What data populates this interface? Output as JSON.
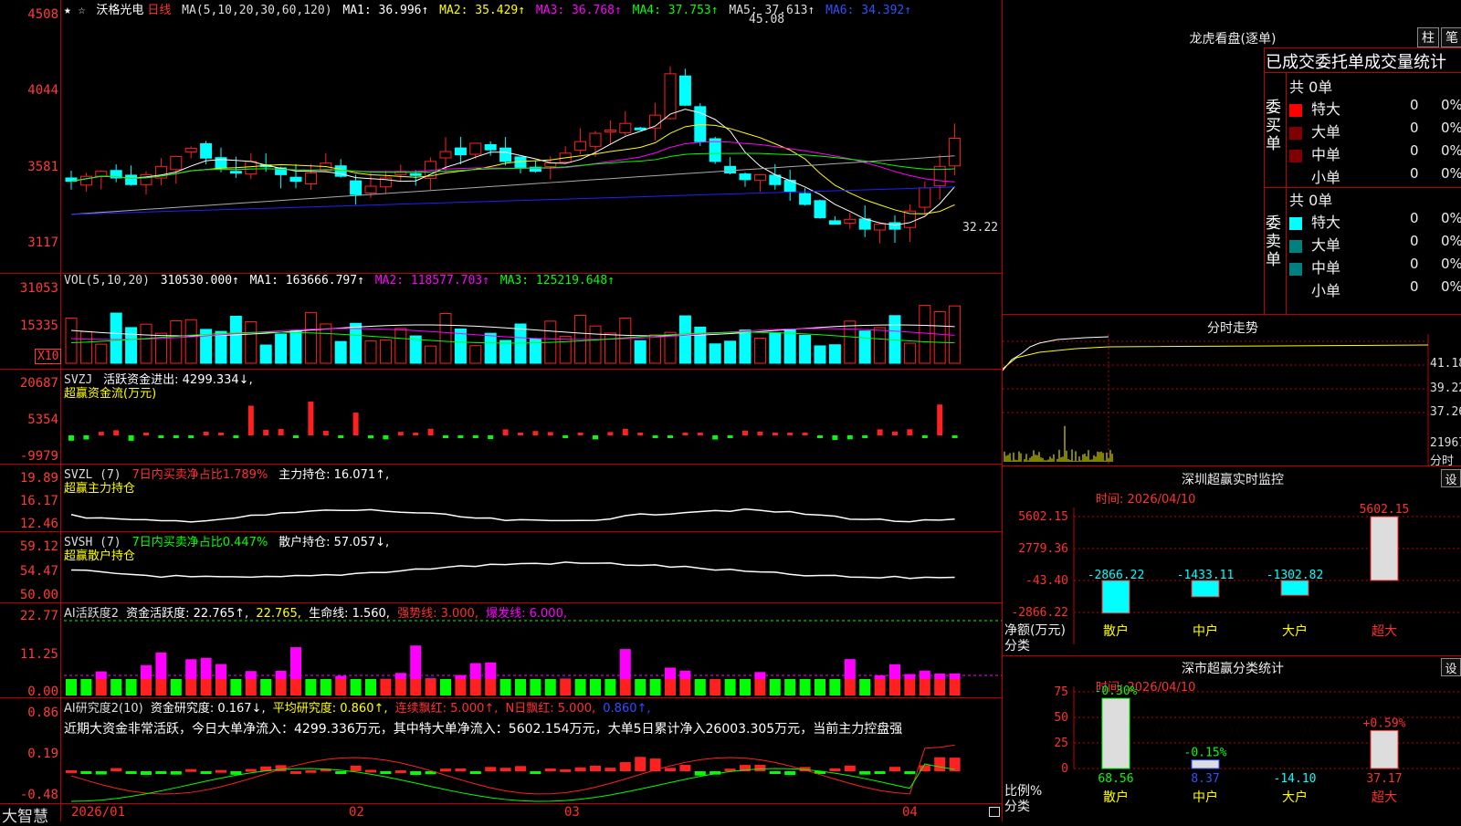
{
  "colors": {
    "up": "#ff2020",
    "down": "#00ffff",
    "bg": "#000000",
    "grid": "#c00000",
    "ma1": "#ffffff",
    "ma2": "#ffff00",
    "ma3": "#ff00ff",
    "ma4": "#00ff00",
    "ma5": "#aaaaaa",
    "ma6": "#2020ff"
  },
  "main": {
    "star": "★ ☆",
    "stock": "沃格光电",
    "period": "日线",
    "ma_params": "MA(5,10,20,30,60,120)",
    "ma1": "MA1: 36.996↑",
    "ma2": "MA2: 35.429↑",
    "ma3": "MA3: 36.768↑",
    "ma4": "MA4: 37.753↑",
    "ma5": "MA5: 37.613↑",
    "ma6": "MA6: 34.392↑",
    "y_labels": [
      "4508",
      "4044",
      "3581",
      "3117"
    ],
    "high_label": "45.08",
    "low_label": "32.22"
  },
  "vol": {
    "label": "VOL(5,10,20)",
    "value": "310530.000↑",
    "ma1": "MA1: 163666.797↑",
    "ma2": "MA2: 118577.703↑",
    "ma3": "MA3: 125219.648↑",
    "y_labels": [
      "31053",
      "15335"
    ],
    "unit": "X10"
  },
  "svzj": {
    "label": "SVZJ",
    "desc": "活跃资金进出: 4299.334↓,",
    "sub": "超赢资金流(万元)",
    "y_labels": [
      "20687",
      "5354",
      "-9979"
    ]
  },
  "svzl": {
    "label": "SVZL (7)",
    "desc": "7日内买卖净占比1.789%",
    "desc2": "主力持仓: 16.071↑,",
    "sub": "超赢主力持仓",
    "y_labels": [
      "19.89",
      "16.17",
      "12.46"
    ]
  },
  "svsh": {
    "label": "SVSH (7)",
    "desc": "7日内买卖净占比0.447%",
    "desc2": "散户持仓: 57.057↓,",
    "sub": "超赢散户持仓",
    "y_labels": [
      "59.12",
      "54.47",
      "50.00"
    ]
  },
  "ai1": {
    "label": "AI活跃度2",
    "desc": "资金活跃度: 22.765↑,",
    "v2": "22.765,",
    "life": "生命线: 1.560,",
    "strong": "强势线: 3.000,",
    "burst": "爆发线: 6.000,",
    "y_labels": [
      "22.77",
      "11.25",
      "0.00"
    ]
  },
  "ai2": {
    "label": "AI研究度2(10)",
    "desc": "资金研究度: 0.167↓,",
    "avg": "平均研究度: 0.860↑,",
    "red": "连续飘红: 5.000↑,",
    "nred": "N日飘红: 5.000,",
    "v": "0.860↑,",
    "comment": "近期大资金非常活跃，今日大单净流入：4299.336万元，其中特大单净流入：5602.154万元，大单5日累计净入26003.305万元，当前主力控盘强",
    "y_labels": [
      "0.86",
      "0.19",
      "-0.48"
    ]
  },
  "xaxis": {
    "app": "大智慧",
    "labels": [
      "2026/01",
      "02",
      "03",
      "04"
    ]
  },
  "right": {
    "top_title": "龙虎看盘(逐单)",
    "btn1": "柱",
    "btn2": "笔",
    "tabs": "已成交委托单成交量统计",
    "buy": {
      "side": "委买单",
      "total": "共 0单",
      "rows": [
        {
          "name": "特大",
          "n": "0",
          "p": "0%"
        },
        {
          "name": "大单",
          "n": "0",
          "p": "0%"
        },
        {
          "name": "中单",
          "n": "0",
          "p": "0%"
        },
        {
          "name": "小单",
          "n": "0",
          "p": "0%"
        }
      ]
    },
    "sell": {
      "side": "委卖单",
      "total": "共 0单",
      "rows": [
        {
          "name": "特大",
          "n": "0",
          "p": "0%"
        },
        {
          "name": "大单",
          "n": "0",
          "p": "0%"
        },
        {
          "name": "中单",
          "n": "0",
          "p": "0%"
        },
        {
          "name": "小单",
          "n": "0",
          "p": "0%"
        }
      ]
    },
    "intraday": {
      "title": "分时走势",
      "y_labels": [
        "41.18",
        "39.22",
        "37.26",
        "21967"
      ],
      "foot": "分时"
    },
    "monitor": {
      "title": "深圳超赢实时监控",
      "set": "设",
      "time": "时间: 2026/04/10",
      "y_labels": [
        "5602.15",
        "2779.36",
        "-43.40",
        "-2866.22"
      ],
      "axis_label": "净额(万元)",
      "axis_label2": "分类",
      "cats": [
        "散户",
        "中户",
        "大户",
        "超大"
      ],
      "values": [
        -2866.22,
        -1433.11,
        -1302.82,
        5602.15
      ],
      "value_labels": [
        "-2866.22",
        "-1433.11",
        "-1302.82",
        "5602.15"
      ]
    },
    "classify": {
      "title": "深市超赢分类统计",
      "set": "设",
      "time": "时间: 2026/04/10",
      "y_labels": [
        "75",
        "50",
        "25",
        "0"
      ],
      "axis_label": "比例%",
      "axis_label2": "分类",
      "cats": [
        "散户",
        "中户",
        "大户",
        "超大"
      ],
      "bar_values": [
        68.56,
        8.37,
        0,
        37.17
      ],
      "change_labels": [
        "-0.30%",
        "-0.15%",
        "",
        "+0.59%"
      ],
      "value_labels": [
        "68.56",
        "8.37",
        "-14.10",
        "37.17"
      ]
    }
  }
}
